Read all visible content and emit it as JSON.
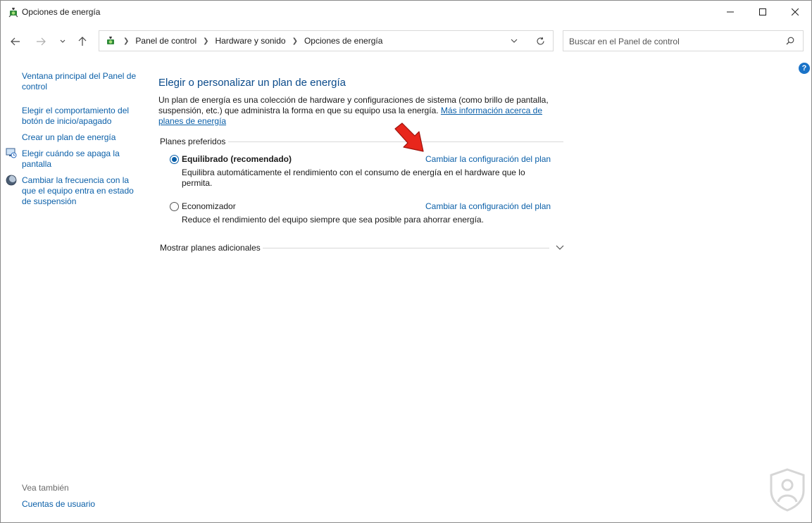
{
  "window": {
    "title": "Opciones de energía",
    "title_icon": "power-options-icon",
    "controls": [
      "minimize-icon",
      "maximize-icon",
      "close-icon"
    ]
  },
  "nav": {
    "breadcrumbs": [
      "Panel de control",
      "Hardware y sonido",
      "Opciones de energía"
    ],
    "search_placeholder": "Buscar en el Panel de control"
  },
  "sidebar": {
    "links": [
      {
        "label": "Ventana principal del Panel de control"
      },
      {
        "label": "Elegir el comportamiento del botón de inicio/apagado"
      },
      {
        "label": "Crear un plan de energía"
      },
      {
        "label": "Elegir cuándo se apaga la pantalla",
        "icon": "monitor-clock-icon"
      },
      {
        "label": "Cambiar la frecuencia con la que el equipo entra en estado de suspensión",
        "icon": "sleep-moon-icon"
      }
    ],
    "see_also": {
      "heading": "Vea también",
      "links": [
        {
          "label": "Cuentas de usuario"
        }
      ]
    }
  },
  "main": {
    "title": "Elegir o personalizar un plan de energía",
    "description": "Un plan de energía es una colección de hardware y configuraciones de sistema (como brillo de pantalla, suspensión, etc.) que administra la forma en que su equipo usa la energía.",
    "description_link": "Más información acerca de planes de energía",
    "preferred_label": "Planes preferidos",
    "plans": [
      {
        "name": "Equilibrado (recomendado)",
        "selected": true,
        "description": "Equilibra automáticamente el rendimiento con el consumo de energía en el hardware que lo permita.",
        "change_link": "Cambiar la configuración del plan"
      },
      {
        "name": "Economizador",
        "selected": false,
        "description": "Reduce el rendimiento del equipo siempre que sea posible para ahorrar energía.",
        "change_link": "Cambiar la configuración del plan"
      }
    ],
    "more_plans_label": "Mostrar planes adicionales"
  },
  "colors": {
    "link": "#0a5fa8",
    "title": "#0a4a8a",
    "annotation_arrow": "#e8261c"
  }
}
